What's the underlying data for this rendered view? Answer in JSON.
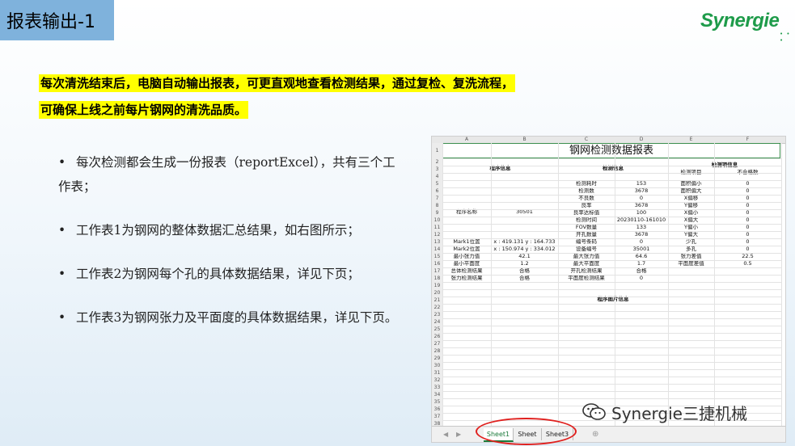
{
  "slide": {
    "title": "报表输出-1",
    "logo": "Synergie",
    "logo_dots": "• • •",
    "highlight_line1": "每次清洗结束后，电脑自动输出报表，可更直观地查看检测结果，通过复检、复洗流程，",
    "highlight_line2": "可确保上线之前每片钢网的清洗品质。",
    "bullets": [
      "每次检测都会生成一份报表（reportExcel），共有三个工作表；",
      "工作表1为钢网的整体数据汇总结果，如右图所示；",
      "工作表2为钢网每个孔的具体数据结果，详见下页；",
      "工作表3为钢网张力及平面度的具体数据结果，详见下页。"
    ],
    "bullet_mark": "•",
    "watermark": "Synergie三捷机械"
  },
  "sheet": {
    "columns": [
      "A",
      "B",
      "C",
      "D",
      "E",
      "F"
    ],
    "rows": [
      "1",
      "2",
      "3",
      "4",
      "5",
      "6",
      "7",
      "8",
      "9",
      "10",
      "11",
      "12",
      "13",
      "14",
      "15",
      "16",
      "17",
      "18",
      "19",
      "20",
      "21",
      "22",
      "23",
      "24",
      "25",
      "26",
      "27",
      "28",
      "29",
      "30",
      "31",
      "32",
      "33",
      "34",
      "35",
      "36",
      "37",
      "38"
    ],
    "title": "钢网检测数据报表",
    "section_program": "程序信息",
    "section_detect": "检测信息",
    "section_items": "检测项信息",
    "item_header": "检测项目",
    "fail_header": "不合格数",
    "program_name_label": "程序名称",
    "program_name_value": "30501",
    "detect_rows": [
      {
        "label": "检测耗时",
        "value": "153"
      },
      {
        "label": "检测数",
        "value": "3678"
      },
      {
        "label": "不良数",
        "value": "0"
      },
      {
        "label": "良率",
        "value": "3678"
      },
      {
        "label": "良率达标值",
        "value": "100"
      },
      {
        "label": "检测时间",
        "value": "20230110-161010"
      },
      {
        "label": "FOV数量",
        "value": "133"
      },
      {
        "label": "开孔数量",
        "value": "3678"
      },
      {
        "label": "编号条码",
        "value": "0"
      },
      {
        "label": "设备编号",
        "value": "35001"
      },
      {
        "label": "最大张力值",
        "value": "64.6"
      },
      {
        "label": "最大平面度",
        "value": "1.7"
      },
      {
        "label": "开孔检测结果",
        "value": "合格"
      },
      {
        "label": "平面度检测结果",
        "value": "0"
      }
    ],
    "item_rows": [
      {
        "label": "面积偏小",
        "value": "0"
      },
      {
        "label": "面积偏大",
        "value": "0"
      },
      {
        "label": "X偏移",
        "value": "0"
      },
      {
        "label": "Y偏移",
        "value": "0"
      },
      {
        "label": "X偏小",
        "value": "0"
      },
      {
        "label": "X偏大",
        "value": "0"
      },
      {
        "label": "Y偏小",
        "value": "0"
      },
      {
        "label": "Y偏大",
        "value": "0"
      },
      {
        "label": "少孔",
        "value": "0"
      },
      {
        "label": "多孔",
        "value": "0"
      },
      {
        "label": "张力差值",
        "value": "22.5"
      },
      {
        "label": "平面度差值",
        "value": "0.5"
      }
    ],
    "a_rows": [
      {
        "label": "Mark1位置",
        "value": "x : 419.131 y : 164.733"
      },
      {
        "label": "Mark2位置",
        "value": "x : 150.974 y : 334.012"
      },
      {
        "label": "最小张力值",
        "value": "42.1"
      },
      {
        "label": "最小平面度",
        "value": "1.2"
      },
      {
        "label": "总体检测结果",
        "value": "合格"
      },
      {
        "label": "张力检测结果",
        "value": "合格"
      }
    ],
    "image_section": "程序图片信息",
    "tabs": [
      "Sheet1",
      "Sheet",
      "Sheet3"
    ],
    "nav_prev": "◀",
    "nav_next": "▶",
    "add_tab": "⊕"
  }
}
